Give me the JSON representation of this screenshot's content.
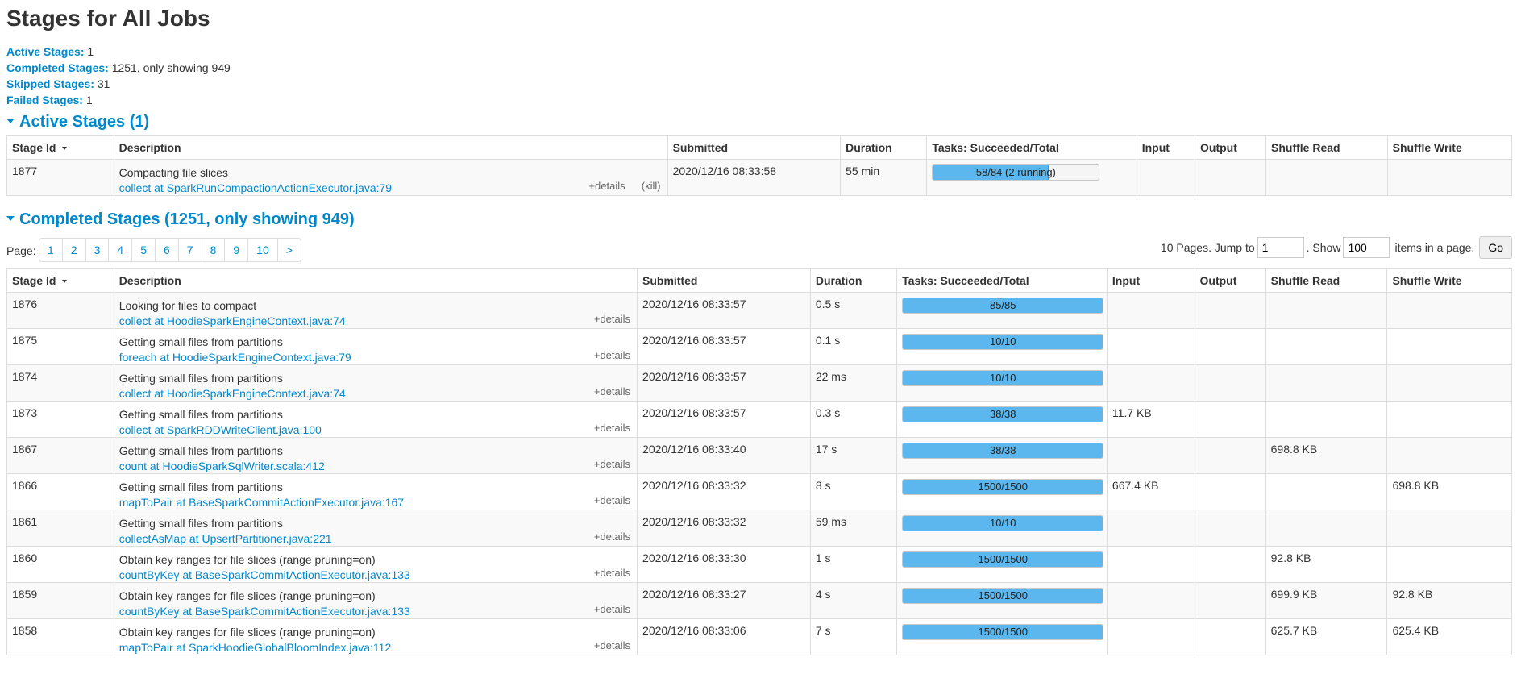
{
  "title": "Stages for All Jobs",
  "summary": [
    {
      "label": "Active Stages:",
      "value": "1"
    },
    {
      "label": "Completed Stages:",
      "value": "1251, only showing 949"
    },
    {
      "label": "Skipped Stages:",
      "value": "31"
    },
    {
      "label": "Failed Stages:",
      "value": "1"
    }
  ],
  "active_section": {
    "title": "Active Stages (1)",
    "headers": [
      "Stage Id",
      "Description",
      "Submitted",
      "Duration",
      "Tasks: Succeeded/Total",
      "Input",
      "Output",
      "Shuffle Read",
      "Shuffle Write"
    ],
    "rows": [
      {
        "id": "1877",
        "desc": "Compacting file slices",
        "link": "collect at SparkRunCompactionActionExecutor.java:79",
        "details": "+details",
        "kill": "(kill)",
        "submitted": "2020/12/16 08:33:58",
        "duration": "55 min",
        "tasks": "58/84 (2 running)",
        "progress": 0.69,
        "input": "",
        "output": "",
        "shuffle_read": "",
        "shuffle_write": ""
      }
    ]
  },
  "completed_section": {
    "title": "Completed Stages (1251, only showing 949)",
    "page_label": "Page:",
    "pages": [
      "1",
      "2",
      "3",
      "4",
      "5",
      "6",
      "7",
      "8",
      "9",
      "10",
      ">"
    ],
    "pages_text": "10 Pages. Jump to",
    "jump_value": "1",
    "show_text": ". Show",
    "show_value": "100",
    "items_text": "items in a page.",
    "go_label": "Go",
    "headers": [
      "Stage Id",
      "Description",
      "Submitted",
      "Duration",
      "Tasks: Succeeded/Total",
      "Input",
      "Output",
      "Shuffle Read",
      "Shuffle Write"
    ],
    "rows": [
      {
        "id": "1876",
        "desc": "Looking for files to compact",
        "link": "collect at HoodieSparkEngineContext.java:74",
        "details": "+details",
        "submitted": "2020/12/16 08:33:57",
        "duration": "0.5 s",
        "tasks": "85/85",
        "progress": 1,
        "input": "",
        "output": "",
        "shuffle_read": "",
        "shuffle_write": ""
      },
      {
        "id": "1875",
        "desc": "Getting small files from partitions",
        "link": "foreach at HoodieSparkEngineContext.java:79",
        "details": "+details",
        "submitted": "2020/12/16 08:33:57",
        "duration": "0.1 s",
        "tasks": "10/10",
        "progress": 1,
        "input": "",
        "output": "",
        "shuffle_read": "",
        "shuffle_write": ""
      },
      {
        "id": "1874",
        "desc": "Getting small files from partitions",
        "link": "collect at HoodieSparkEngineContext.java:74",
        "details": "+details",
        "submitted": "2020/12/16 08:33:57",
        "duration": "22 ms",
        "tasks": "10/10",
        "progress": 1,
        "input": "",
        "output": "",
        "shuffle_read": "",
        "shuffle_write": ""
      },
      {
        "id": "1873",
        "desc": "Getting small files from partitions",
        "link": "collect at SparkRDDWriteClient.java:100",
        "details": "+details",
        "submitted": "2020/12/16 08:33:57",
        "duration": "0.3 s",
        "tasks": "38/38",
        "progress": 1,
        "input": "11.7 KB",
        "output": "",
        "shuffle_read": "",
        "shuffle_write": ""
      },
      {
        "id": "1867",
        "desc": "Getting small files from partitions",
        "link": "count at HoodieSparkSqlWriter.scala:412",
        "details": "+details",
        "submitted": "2020/12/16 08:33:40",
        "duration": "17 s",
        "tasks": "38/38",
        "progress": 1,
        "input": "",
        "output": "",
        "shuffle_read": "698.8 KB",
        "shuffle_write": ""
      },
      {
        "id": "1866",
        "desc": "Getting small files from partitions",
        "link": "mapToPair at BaseSparkCommitActionExecutor.java:167",
        "details": "+details",
        "submitted": "2020/12/16 08:33:32",
        "duration": "8 s",
        "tasks": "1500/1500",
        "progress": 1,
        "input": "667.4 KB",
        "output": "",
        "shuffle_read": "",
        "shuffle_write": "698.8 KB"
      },
      {
        "id": "1861",
        "desc": "Getting small files from partitions",
        "link": "collectAsMap at UpsertPartitioner.java:221",
        "details": "+details",
        "submitted": "2020/12/16 08:33:32",
        "duration": "59 ms",
        "tasks": "10/10",
        "progress": 1,
        "input": "",
        "output": "",
        "shuffle_read": "",
        "shuffle_write": ""
      },
      {
        "id": "1860",
        "desc": "Obtain key ranges for file slices (range pruning=on)",
        "link": "countByKey at BaseSparkCommitActionExecutor.java:133",
        "details": "+details",
        "submitted": "2020/12/16 08:33:30",
        "duration": "1 s",
        "tasks": "1500/1500",
        "progress": 1,
        "input": "",
        "output": "",
        "shuffle_read": "92.8 KB",
        "shuffle_write": ""
      },
      {
        "id": "1859",
        "desc": "Obtain key ranges for file slices (range pruning=on)",
        "link": "countByKey at BaseSparkCommitActionExecutor.java:133",
        "details": "+details",
        "submitted": "2020/12/16 08:33:27",
        "duration": "4 s",
        "tasks": "1500/1500",
        "progress": 1,
        "input": "",
        "output": "",
        "shuffle_read": "699.9 KB",
        "shuffle_write": "92.8 KB"
      },
      {
        "id": "1858",
        "desc": "Obtain key ranges for file slices (range pruning=on)",
        "link": "mapToPair at SparkHoodieGlobalBloomIndex.java:112",
        "details": "+details",
        "submitted": "2020/12/16 08:33:06",
        "duration": "7 s",
        "tasks": "1500/1500",
        "progress": 1,
        "input": "",
        "output": "",
        "shuffle_read": "625.7 KB",
        "shuffle_write": "625.4 KB"
      }
    ]
  },
  "colors": {
    "link": "#0088cc",
    "progress_fill": "#5bb7ee"
  }
}
